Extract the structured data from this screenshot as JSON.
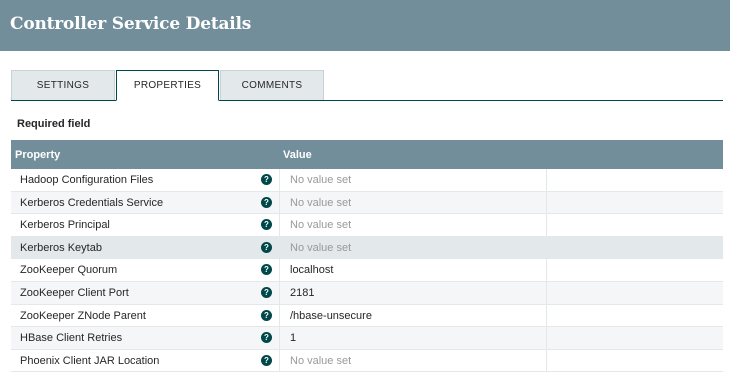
{
  "header": {
    "title": "Controller Service Details"
  },
  "tabs": [
    {
      "label": "SETTINGS"
    },
    {
      "label": "PROPERTIES"
    },
    {
      "label": "COMMENTS"
    }
  ],
  "required_label": "Required field",
  "table": {
    "headers": {
      "property": "Property",
      "value": "Value"
    },
    "rows": [
      {
        "name": "Hadoop Configuration Files",
        "value": "No value set"
      },
      {
        "name": "Kerberos Credentials Service",
        "value": "No value set"
      },
      {
        "name": "Kerberos Principal",
        "value": "No value set"
      },
      {
        "name": "Kerberos Keytab",
        "value": "No value set"
      },
      {
        "name": "ZooKeeper Quorum",
        "value": "localhost"
      },
      {
        "name": "ZooKeeper Client Port",
        "value": "2181"
      },
      {
        "name": "ZooKeeper ZNode Parent",
        "value": "/hbase-unsecure"
      },
      {
        "name": "HBase Client Retries",
        "value": "1"
      },
      {
        "name": "Phoenix Client JAR Location",
        "value": "No value set"
      }
    ],
    "help_glyph": "?"
  },
  "colors": {
    "header_bg": "#728e9b",
    "accent": "#004849",
    "placeholder_text": "#999999"
  }
}
